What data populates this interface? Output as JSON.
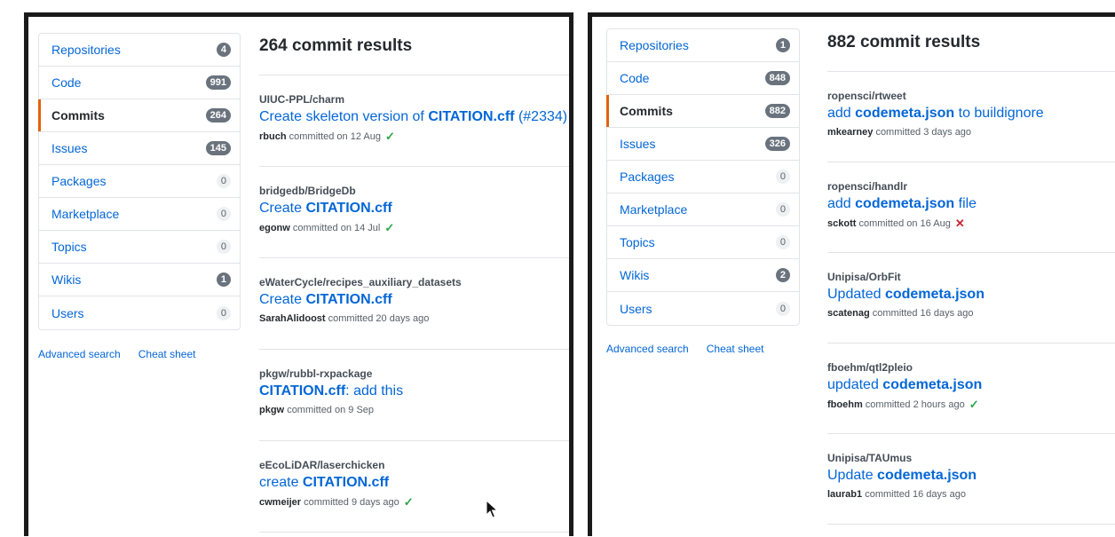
{
  "colors": {
    "link": "#0366d6",
    "selected_marker": "#e36209",
    "success": "#28a745",
    "failure": "#cb2431"
  },
  "left": {
    "sidebar": [
      {
        "label": "Repositories",
        "count": "4"
      },
      {
        "label": "Code",
        "count": "991"
      },
      {
        "label": "Commits",
        "count": "264"
      },
      {
        "label": "Issues",
        "count": "145"
      },
      {
        "label": "Packages",
        "count": "0"
      },
      {
        "label": "Marketplace",
        "count": "0"
      },
      {
        "label": "Topics",
        "count": "0"
      },
      {
        "label": "Wikis",
        "count": "1"
      },
      {
        "label": "Users",
        "count": "0"
      }
    ],
    "links": {
      "advanced": "Advanced search",
      "cheat": "Cheat sheet"
    },
    "title": "264 commit results",
    "commits": [
      {
        "repo": "UIUC-PPL/charm",
        "pre": "Create skeleton version of ",
        "bold": "CITATION.cff",
        "post": " (#2334)",
        "author": "rbuch",
        "time": "committed on 12 Aug",
        "status": "success"
      },
      {
        "repo": "bridgedb/BridgeDb",
        "pre": "Create ",
        "bold": "CITATION.cff",
        "post": "",
        "author": "egonw",
        "time": "committed on 14 Jul",
        "status": "success"
      },
      {
        "repo": "eWaterCycle/recipes_auxiliary_datasets",
        "pre": "Create ",
        "bold": "CITATION.cff",
        "post": "",
        "author": "SarahAlidoost",
        "time": "committed 20 days ago",
        "status": ""
      },
      {
        "repo": "pkgw/rubbl-rxpackage",
        "pre": "",
        "bold": "CITATION.cff",
        "post": ": add this",
        "author": "pkgw",
        "time": "committed on 9 Sep",
        "status": ""
      },
      {
        "repo": "eEcoLiDAR/laserchicken",
        "pre": "create ",
        "bold": "CITATION.cff",
        "post": "",
        "author": "cwmeijer",
        "time": "committed 9 days ago",
        "status": "success"
      }
    ]
  },
  "right": {
    "sidebar": [
      {
        "label": "Repositories",
        "count": "1"
      },
      {
        "label": "Code",
        "count": "848"
      },
      {
        "label": "Commits",
        "count": "882"
      },
      {
        "label": "Issues",
        "count": "326"
      },
      {
        "label": "Packages",
        "count": "0"
      },
      {
        "label": "Marketplace",
        "count": "0"
      },
      {
        "label": "Topics",
        "count": "0"
      },
      {
        "label": "Wikis",
        "count": "2"
      },
      {
        "label": "Users",
        "count": "0"
      }
    ],
    "links": {
      "advanced": "Advanced search",
      "cheat": "Cheat sheet"
    },
    "title": "882 commit results",
    "commits": [
      {
        "repo": "ropensci/rtweet",
        "pre": "add ",
        "bold": "codemeta.json",
        "post": " to buildignore",
        "author": "mkearney",
        "time": "committed 3 days ago",
        "status": ""
      },
      {
        "repo": "ropensci/handlr",
        "pre": "add ",
        "bold": "codemeta.json",
        "post": " file",
        "author": "sckott",
        "time": "committed on 16 Aug",
        "status": "failure"
      },
      {
        "repo": "Unipisa/OrbFit",
        "pre": "Updated ",
        "bold": "codemeta.json",
        "post": "",
        "author": "scatenag",
        "time": "committed 16 days ago",
        "status": ""
      },
      {
        "repo": "fboehm/qtl2pleio",
        "pre": "updated ",
        "bold": "codemeta.json",
        "post": "",
        "author": "fboehm",
        "time": "committed 2 hours ago",
        "status": "success"
      },
      {
        "repo": "Unipisa/TAUmus",
        "pre": "Update ",
        "bold": "codemeta.json",
        "post": "",
        "author": "laurab1",
        "time": "committed 16 days ago",
        "status": ""
      }
    ]
  }
}
